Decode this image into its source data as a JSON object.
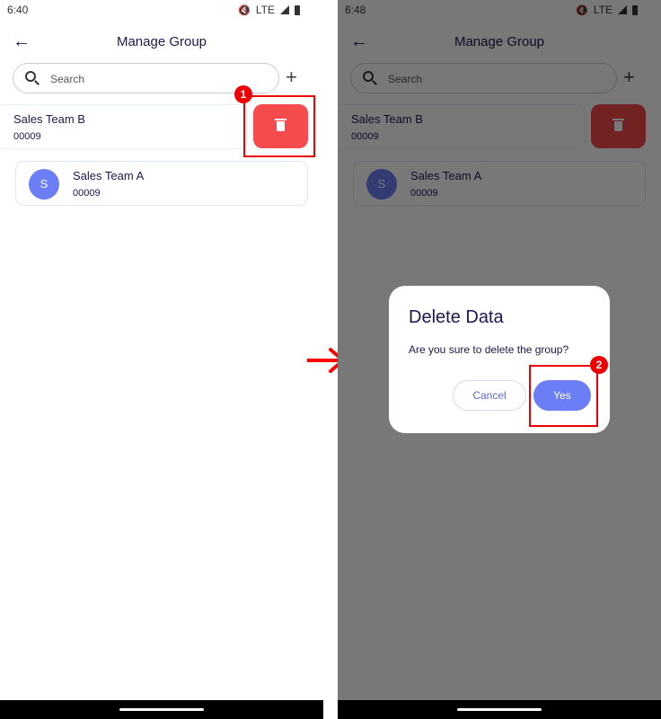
{
  "screens": [
    {
      "status": {
        "time": "6:40",
        "network": "LTE"
      },
      "appbar": {
        "title": "Manage Group"
      },
      "search": {
        "placeholder": "Search"
      },
      "groups": [
        {
          "name": "Sales Team B",
          "code": "00009"
        },
        {
          "name": "Sales Team A",
          "code": "00009",
          "avatar": "S"
        }
      ],
      "step_badge": "1"
    },
    {
      "status": {
        "time": "6:48",
        "network": "LTE"
      },
      "appbar": {
        "title": "Manage Group"
      },
      "search": {
        "placeholder": "Search"
      },
      "groups": [
        {
          "name": "Sales Team B",
          "code": "00009"
        },
        {
          "name": "Sales Team A",
          "code": "00009",
          "avatar": "S"
        }
      ],
      "dialog": {
        "title": "Delete Data",
        "message": "Are you sure to delete the group?",
        "cancel_label": "Cancel",
        "confirm_label": "Yes"
      },
      "step_badge": "2"
    }
  ],
  "colors": {
    "accent": "#6c7ef5",
    "danger": "#f54a4e",
    "highlight": "#e00000",
    "text": "#1a1850"
  }
}
